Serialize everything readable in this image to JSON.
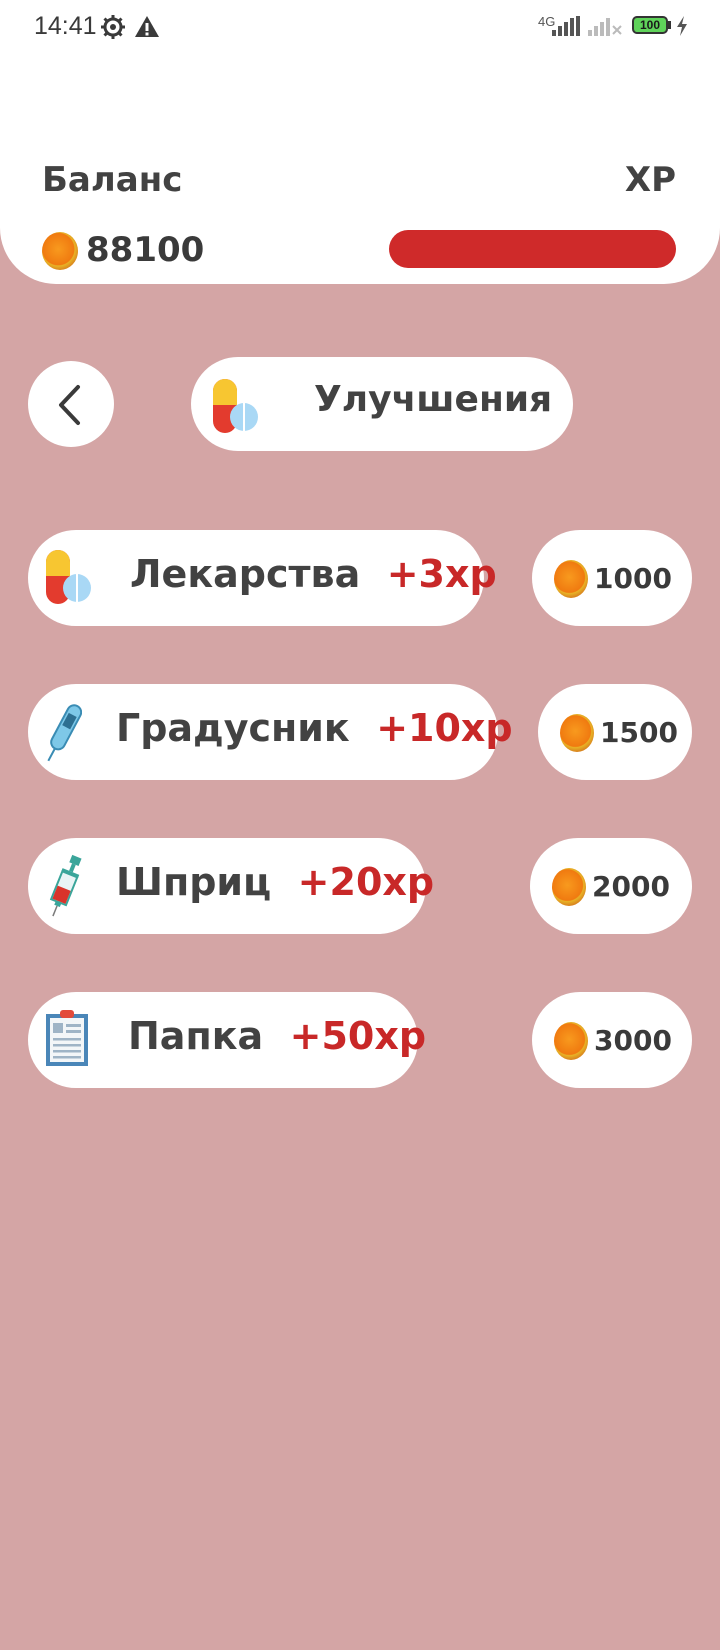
{
  "status_bar": {
    "time": "14:41",
    "network": "4G",
    "battery": "100"
  },
  "header": {
    "balance_label": "Баланс",
    "balance_value": "88100",
    "xp_label": "XP",
    "xp_progress": 1.0,
    "xp_bar_color": "#cf2a2a"
  },
  "nav": {
    "back_icon": "chevron-left-icon",
    "title": "Улучшения",
    "title_icon": "pill-icon"
  },
  "items": [
    {
      "name": "Лекарства",
      "xp": "+3xp",
      "price": "1000",
      "icon": "pill-icon"
    },
    {
      "name": "Градусник",
      "xp": "+10xp",
      "price": "1500",
      "icon": "thermometer-icon"
    },
    {
      "name": "Шприц",
      "xp": "+20xp",
      "price": "2000",
      "icon": "syringe-icon"
    },
    {
      "name": "Папка",
      "xp": "+50xp",
      "price": "3000",
      "icon": "folder-icon"
    }
  ],
  "colors": {
    "background": "#d4a5a5",
    "card": "#ffffff",
    "accent_red": "#c82828",
    "coin": "#f07a10"
  }
}
